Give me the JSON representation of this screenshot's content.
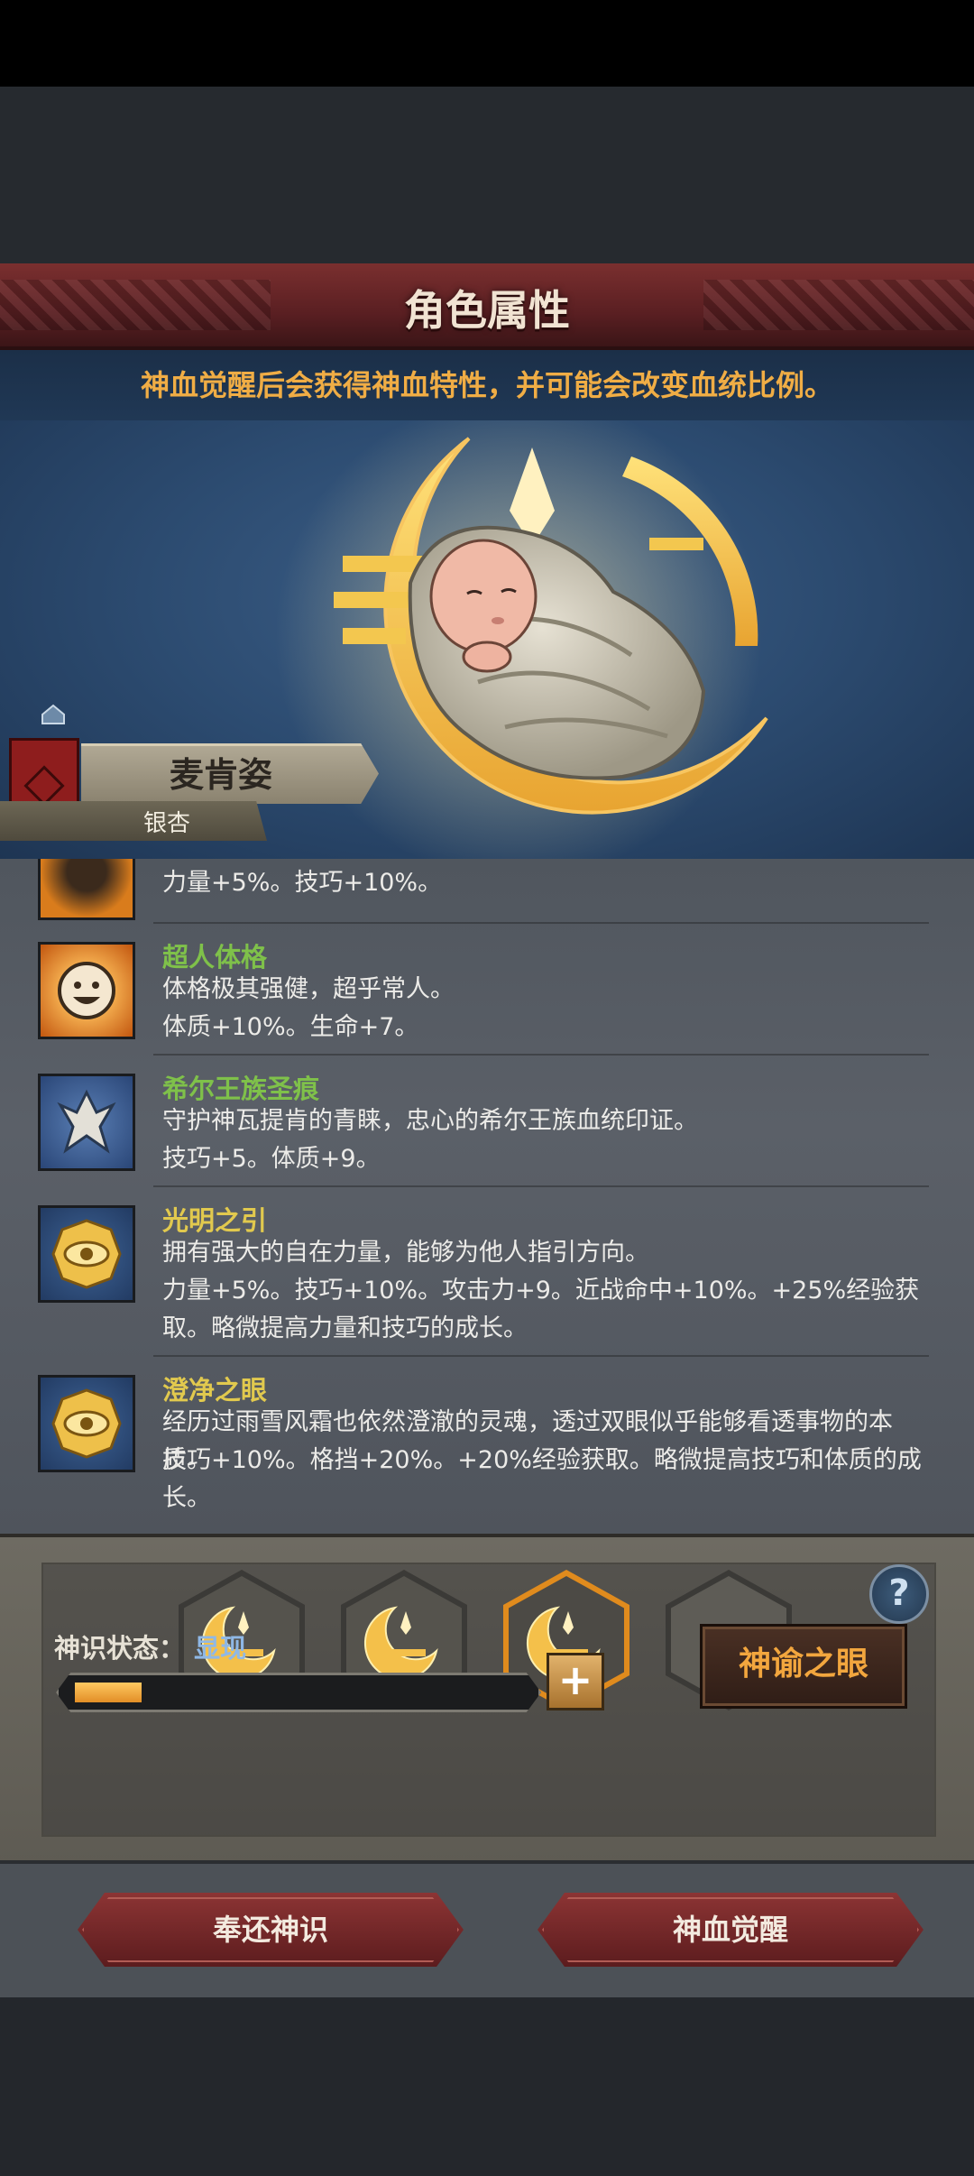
{
  "header": {
    "title": "角色属性"
  },
  "notice": "神血觉醒后会获得神血特性，并可能会改变血统比例。",
  "character": {
    "name": "麦肯姿",
    "sub_label": "银杏"
  },
  "traits": [
    {
      "name": "",
      "desc1": "力量+5%。技巧+10%。",
      "desc2": "",
      "desc3": "",
      "color": "#9ecb56",
      "icon": "flame-face-icon"
    },
    {
      "name": "超人体格",
      "desc1": "体格极其强健，超乎常人。",
      "desc2": "体质+10%。生命+7。",
      "desc3": "",
      "color": "#7fc14a",
      "icon": "smiling-sun-icon"
    },
    {
      "name": "希尔王族圣痕",
      "desc1": "守护神瓦提肯的青睐，忠心的希尔王族血统印证。",
      "desc2": "技巧+5。体质+9。",
      "desc3": "",
      "color": "#7fc14a",
      "icon": "wing-crest-icon"
    },
    {
      "name": "光明之引",
      "desc1": "拥有强大的自在力量，能够为他人指引方向。",
      "desc2": "力量+5%。技巧+10%。攻击力+9。近战命中+10%。+25%经验获",
      "desc3": "取。略微提高力量和技巧的成长。",
      "color": "#e1c94e",
      "icon": "golden-eye-icon"
    },
    {
      "name": "澄净之眼",
      "desc1": "经历过雨雪风霜也依然澄澈的灵魂，透过双眼似乎能够看透事物的本质。",
      "desc2": "技巧+10%。格挡+20%。+20%经验获取。略微提高技巧和体质的成",
      "desc3": "长。",
      "color": "#e1c94e",
      "icon": "golden-eye-icon"
    }
  ],
  "divinity": {
    "slots": [
      "filled",
      "filled",
      "active",
      "empty"
    ],
    "status_label": "神识状态：",
    "status_value": "显现",
    "progress": 0.15,
    "plus_label": "+",
    "oracle_label": "神谕之眼",
    "help_label": "?"
  },
  "actions": {
    "return_label": "奉还神识",
    "awaken_label": "神血觉醒"
  },
  "colors": {
    "accent_orange": "#f0ad45",
    "title_red": "#6b2628",
    "status_blue": "#8fb8e6"
  }
}
